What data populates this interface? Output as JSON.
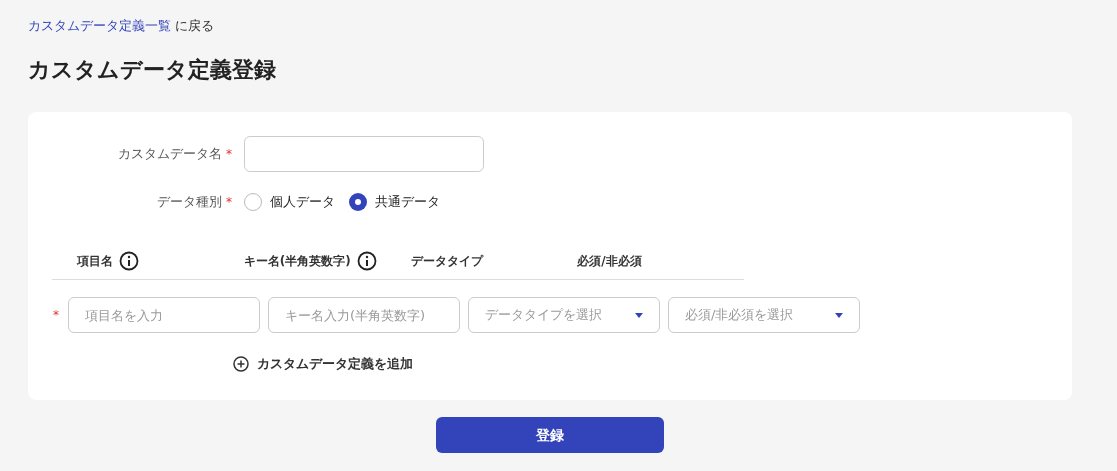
{
  "breadcrumb": {
    "link": "カスタムデータ定義一覧",
    "text": "に戻る"
  },
  "title": "カスタムデータ定義登録",
  "form": {
    "name_field": {
      "label": "カスタムデータ名",
      "required_mark": "*"
    },
    "data_kind": {
      "label": "データ種別",
      "required_mark": "*",
      "options": [
        {
          "label": "個人データ",
          "selected": false
        },
        {
          "label": "共通データ",
          "selected": true
        }
      ]
    }
  },
  "table": {
    "columns": [
      {
        "label": "項目名",
        "info": true
      },
      {
        "label": "キー名(半角英数字)",
        "info": true
      },
      {
        "label": "データタイプ",
        "info": false
      },
      {
        "label": "必須/非必須",
        "info": false
      }
    ],
    "rows": [
      {
        "required_mark": "*",
        "fields": [
          {
            "kind": "input",
            "placeholder": "項目名を入力"
          },
          {
            "kind": "input",
            "placeholder": "キー名入力(半角英数字)"
          },
          {
            "kind": "select",
            "placeholder": "データタイプを選択"
          },
          {
            "kind": "select",
            "placeholder": "必須/非必須を選択"
          }
        ]
      }
    ],
    "add_button": "カスタムデータ定義を追加"
  },
  "submit_button": "登録"
}
